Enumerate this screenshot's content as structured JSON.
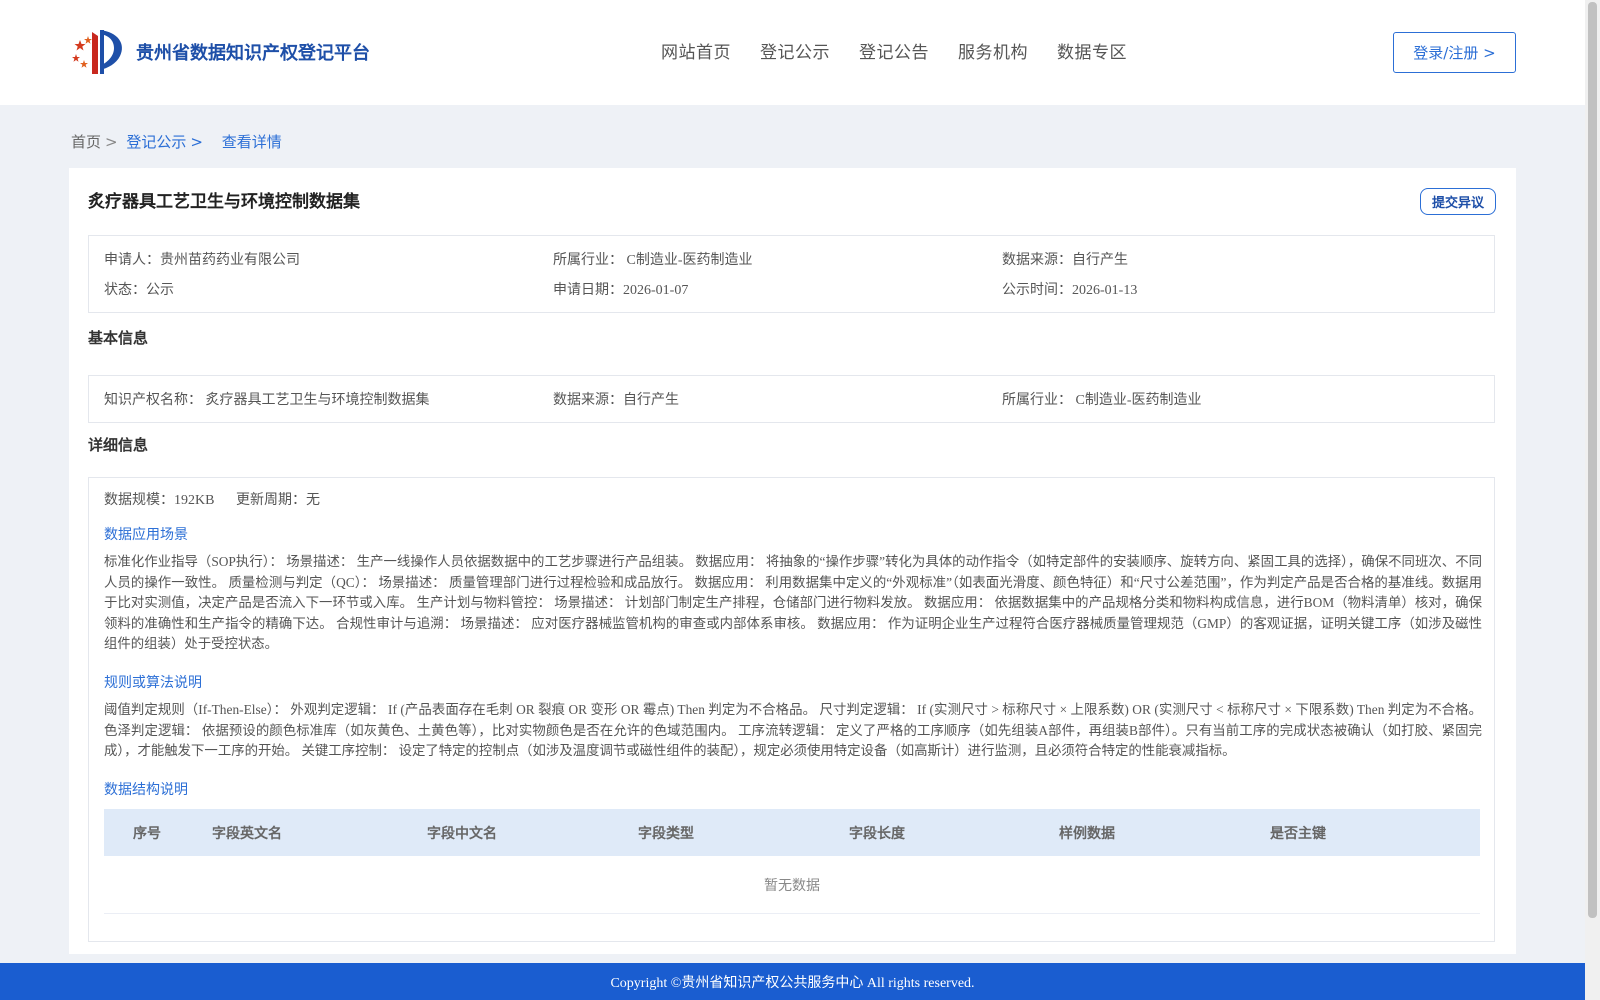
{
  "header": {
    "site_title": "贵州省数据知识产权登记平台",
    "nav": [
      "网站首页",
      "登记公示",
      "登记公告",
      "服务机构",
      "数据专区"
    ],
    "login_label": "登录/注册 >"
  },
  "breadcrumb": {
    "home": "首页",
    "sep": ">",
    "section": "登记公示",
    "current": "查看详情"
  },
  "detail": {
    "title": "炙疗器具工艺卫生与环境控制数据集",
    "objection_label": "提交异议",
    "meta": {
      "applicant": "申请人：贵州苗药药业有限公司",
      "industry": "所属行业： C制造业-医药制造业",
      "source": "数据来源：自行产生",
      "status": "状态：公示",
      "apply_date": "申请日期：2026-01-07",
      "publish_date": "公示时间：2026-01-13"
    },
    "basic_title": "基本信息",
    "basic": {
      "name": "知识产权名称： 炙疗器具工艺卫生与环境控制数据集",
      "source": "数据来源：自行产生",
      "industry": "所属行业： C制造业-医药制造业"
    },
    "detail_title": "详细信息",
    "scale": "数据规模：192KB",
    "update_cycle": "更新周期：无",
    "scenario_title": "数据应用场景",
    "scenario_text": "标准化作业指导（SOP执行）： 场景描述： 生产一线操作人员依据数据中的工艺步骤进行产品组装。 数据应用： 将抽象的“操作步骤”转化为具体的动作指令（如特定部件的安装顺序、旋转方向、紧固工具的选择），确保不同班次、不同人员的操作一致性。 质量检测与判定（QC）： 场景描述： 质量管理部门进行过程检验和成品放行。 数据应用： 利用数据集中定义的“外观标准”（如表面光滑度、颜色特征）和“尺寸公差范围”，作为判定产品是否合格的基准线。数据用于比对实测值，决定产品是否流入下一环节或入库。 生产计划与物料管控： 场景描述： 计划部门制定生产排程，仓储部门进行物料发放。 数据应用： 依据数据集中的产品规格分类和物料构成信息，进行BOM（物料清单）核对，确保领料的准确性和生产指令的精确下达。 合规性审计与追溯： 场景描述： 应对医疗器械监管机构的审查或内部体系审核。 数据应用： 作为证明企业生产过程符合医疗器械质量管理规范（GMP）的客观证据，证明关键工序（如涉及磁性组件的组装）处于受控状态。",
    "rule_title": "规则或算法说明",
    "rule_text": "阈值判定规则（If-Then-Else）： 外观判定逻辑： If (产品表面存在毛刺 OR 裂痕 OR 变形 OR 霉点) Then 判定为不合格品。 尺寸判定逻辑： If (实测尺寸 > 标称尺寸 × 上限系数) OR (实测尺寸 < 标称尺寸 × 下限系数) Then 判定为不合格。 色泽判定逻辑： 依据预设的颜色标准库（如灰黄色、土黄色等），比对实物颜色是否在允许的色域范围内。 工序流转逻辑： 定义了严格的工序顺序（如先组装A部件，再组装B部件）。只有当前工序的完成状态被确认（如打胶、紧固完成），才能触发下一工序的开始。 关键工序控制： 设定了特定的控制点（如涉及温度调节或磁性组件的装配），规定必须使用特定设备（如高斯计）进行监测，且必须符合特定的性能衰减指标。",
    "structure_title": "数据结构说明",
    "table_columns": [
      "序号",
      "字段英文名",
      "字段中文名",
      "字段类型",
      "字段长度",
      "样例数据",
      "是否主键"
    ],
    "table_empty": "暂无数据"
  },
  "footer": {
    "copyright": "Copyright ©贵州省知识产权公共服务中心 All rights reserved."
  }
}
